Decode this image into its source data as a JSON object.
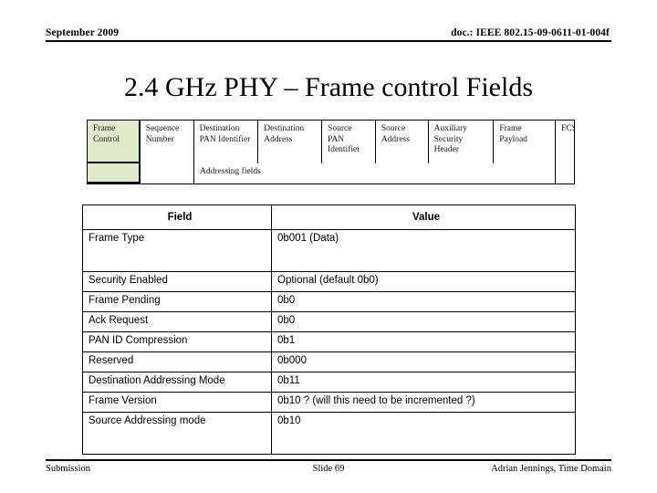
{
  "header": {
    "date": "September 2009",
    "doc_id": "doc.: IEEE 802.15-09-0611-01-004f"
  },
  "title": "2.4 GHz PHY – Frame control Fields",
  "frame_diagram": {
    "highlight_color": "#dfeacb",
    "cells": [
      {
        "label": "Frame Control",
        "highlighted": true
      },
      {
        "label": "Sequence Number",
        "highlighted": false
      },
      {
        "label": "Destination PAN Identifier",
        "highlighted": false
      },
      {
        "label": "Destination Address",
        "highlighted": false
      },
      {
        "label": "Source PAN Identifier",
        "highlighted": false
      },
      {
        "label": "Source Address",
        "highlighted": false
      },
      {
        "label": "Auxiliary Security Header",
        "highlighted": false
      },
      {
        "label": "Frame Payload",
        "highlighted": false
      },
      {
        "label": "FCS",
        "highlighted": false
      }
    ],
    "group_label": "Addressing fields"
  },
  "table": {
    "columns": [
      "Field",
      "Value"
    ],
    "rows": [
      {
        "field": "Frame  Type",
        "value": "0b001 (Data)",
        "tall": true
      },
      {
        "field": "Security Enabled",
        "value": "Optional (default 0b0)",
        "tall": false
      },
      {
        "field": "Frame Pending",
        "value": "0b0",
        "tall": false
      },
      {
        "field": "Ack Request",
        "value": "0b0",
        "tall": false
      },
      {
        "field": "PAN ID Compression",
        "value": "0b1",
        "tall": false
      },
      {
        "field": "Reserved",
        "value": "0b000",
        "tall": false
      },
      {
        "field": "Destination Addressing Mode",
        "value": "0b11",
        "tall": false
      },
      {
        "field": "Frame Version",
        "value": "0b10 ? (will this need to be incremented ?)",
        "tall": false
      },
      {
        "field": "Source Addressing mode",
        "value": "0b10",
        "tall": true
      }
    ]
  },
  "footer": {
    "left": "Submission",
    "center": "Slide 69",
    "right": "Adrian Jennings, Time Domain"
  }
}
